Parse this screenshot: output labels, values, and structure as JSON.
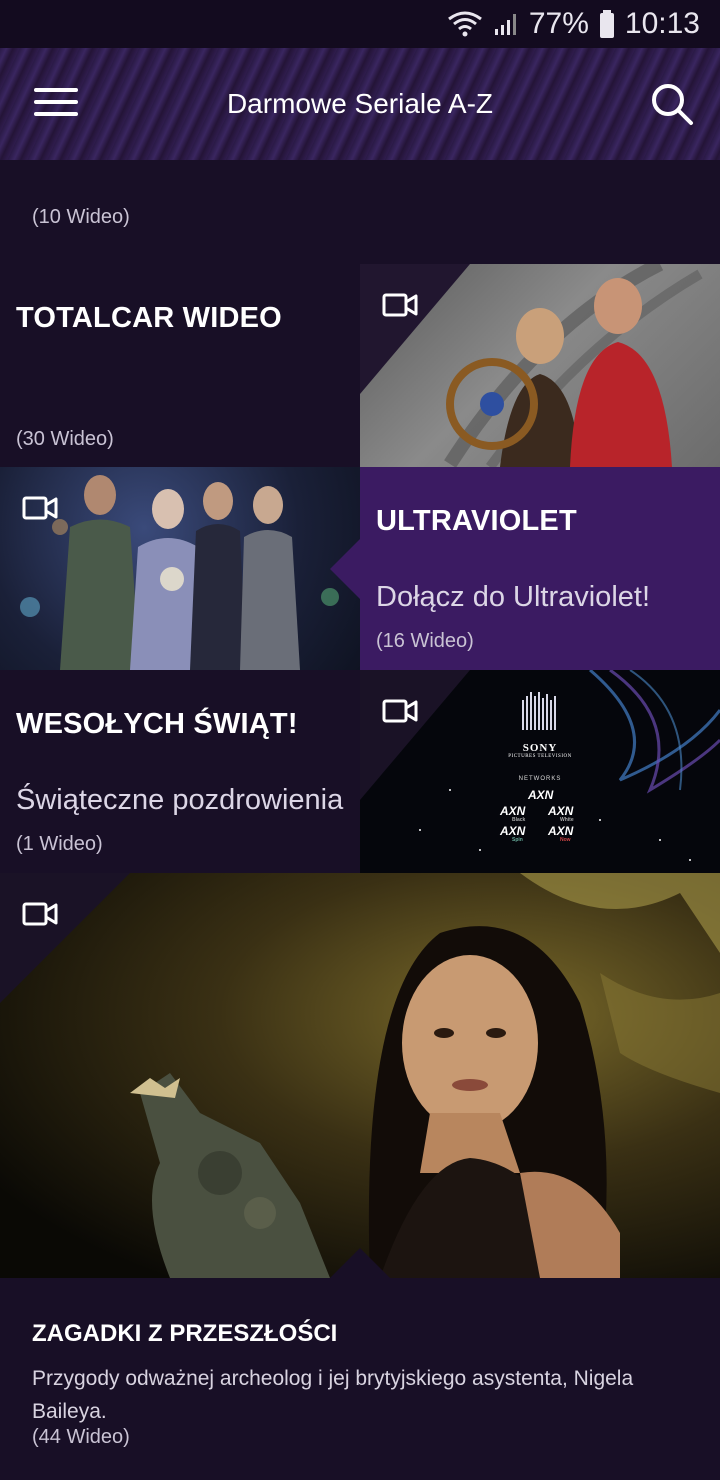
{
  "status_bar": {
    "battery": "77%",
    "time": "10:13"
  },
  "app_bar": {
    "title": "Darmowe Seriale A-Z"
  },
  "top_count": "(10 Wideo)",
  "tiles": [
    {
      "title": "TOTALCAR WIDEO",
      "subtitle": "",
      "count": "(30 Wideo)"
    },
    {
      "title": "ULTRAVIOLET",
      "subtitle": "Dołącz do Ultraviolet!",
      "count": "(16 Wideo)"
    },
    {
      "title": "WESOŁYCH ŚWIĄT!",
      "subtitle": "Świąteczne pozdrowienia",
      "count": "(1 Wideo)"
    }
  ],
  "sony_logo": {
    "brand": "SONY",
    "line": "PICTURES TELEVISION",
    "networks": "NETWORKS",
    "channels": [
      "AXN",
      "AXN",
      "AXN",
      "AXN",
      "AXN"
    ],
    "channel_tags": [
      "Black",
      "White",
      "Spin",
      "Now"
    ]
  },
  "featured": {
    "title": "ZAGADKI Z PRZESZŁOŚCI",
    "description": "Przygody odważnej archeolog i jej brytyjskiego asystenta, Nigela Baileya.",
    "count": "(44 Wideo)"
  },
  "colors": {
    "background": "#180f26",
    "accent_purple": "#3b1b62"
  }
}
